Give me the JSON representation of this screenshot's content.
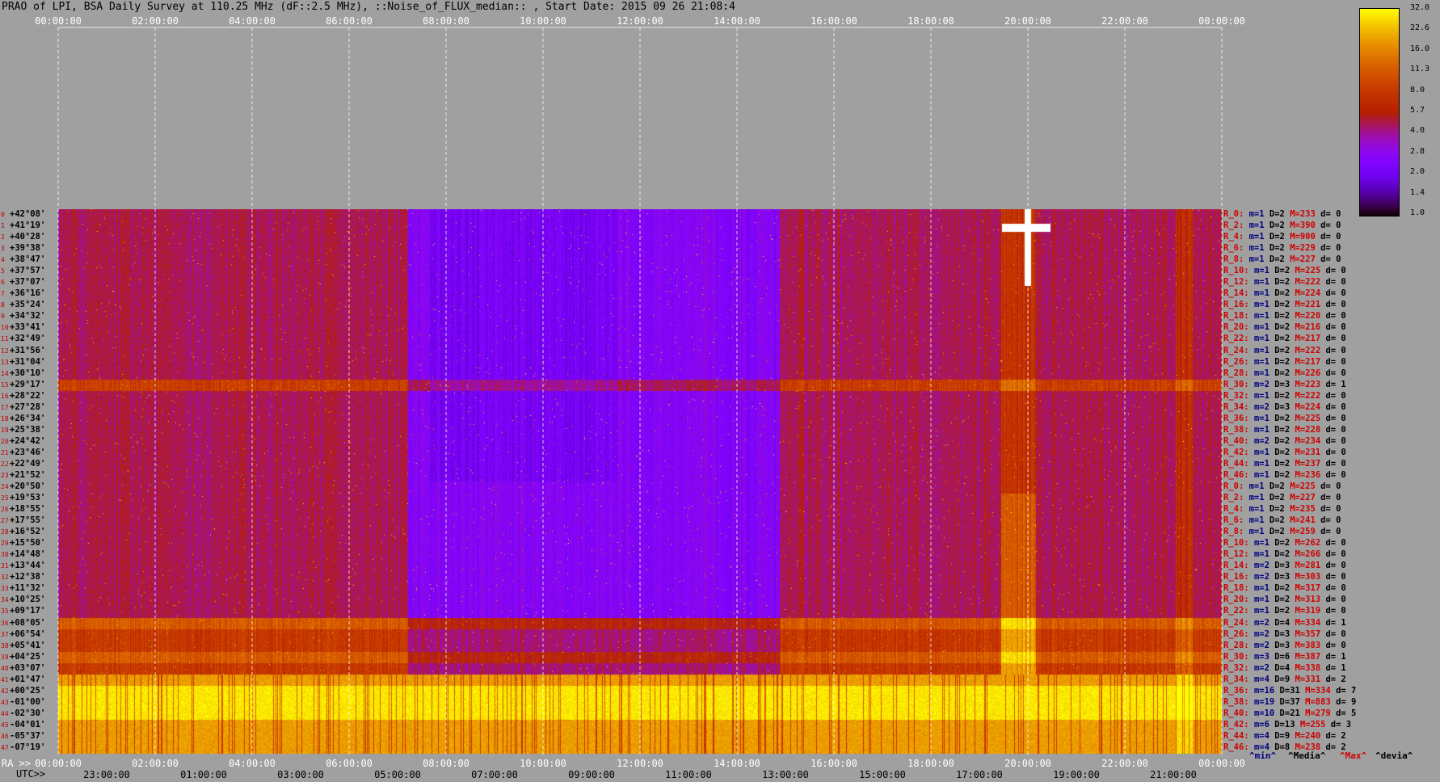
{
  "header": {
    "title": "PRAO of LPI, BSA Daily Survey at 110.25 MHz (dF::2.5 MHz), ::Noise_of_FLUX_median:: , Start Date: 2015 09 26 21:08:4"
  },
  "chart_data": {
    "type": "heatmap",
    "title": "PRAO of LPI, BSA Daily Survey at 110.25 MHz (dF::2.5 MHz), ::Noise_of_FLUX_median:: , Start Date: 2015 09 26 21:08:4",
    "x_top_ticks": [
      "00:00:00",
      "02:00:00",
      "04:00:00",
      "06:00:00",
      "08:00:00",
      "10:00:00",
      "12:00:00",
      "14:00:00",
      "16:00:00",
      "18:00:00",
      "20:00:00",
      "22:00:00",
      "00:00:00"
    ],
    "ra_label": "RA >>",
    "utc_label": "UTC>>",
    "x_bottom_ra_ticks": [
      "00:00:00",
      "02:00:00",
      "04:00:00",
      "06:00:00",
      "08:00:00",
      "10:00:00",
      "12:00:00",
      "14:00:00",
      "16:00:00",
      "18:00:00",
      "20:00:00",
      "22:00:00",
      "00:00:00"
    ],
    "x_bottom_utc_ticks": [
      "23:00:00",
      "01:00:00",
      "03:00:00",
      "05:00:00",
      "07:00:00",
      "09:00:00",
      "11:00:00",
      "13:00:00",
      "15:00:00",
      "17:00:00",
      "19:00:00",
      "21:00:00"
    ],
    "declinations": [
      "+42°08'",
      "+41°19'",
      "+40°28'",
      "+39°38'",
      "+38°47'",
      "+37°57'",
      "+37°07'",
      "+36°16'",
      "+35°24'",
      "+34°32'",
      "+33°41'",
      "+32°49'",
      "+31°56'",
      "+31°04'",
      "+30°10'",
      "+29°17'",
      "+28°22'",
      "+27°28'",
      "+26°34'",
      "+25°38'",
      "+24°42'",
      "+23°46'",
      "+22°49'",
      "+21°52'",
      "+20°50'",
      "+19°53'",
      "+18°55'",
      "+17°55'",
      "+16°52'",
      "+15°50'",
      "+14°48'",
      "+13°44'",
      "+12°38'",
      "+11°32'",
      "+10°25'",
      "+09°17'",
      "+08°05'",
      "+06°54'",
      "+05°41'",
      "+04°25'",
      "+03°07'",
      "+01°47'",
      "+00°25'",
      "-01°00'",
      "-02°30'",
      "-04°01'",
      "-05°37'",
      "-07°19'"
    ],
    "row_indices": [
      "0",
      "1",
      "2",
      "3",
      "4",
      "5",
      "6",
      "7",
      "8",
      "9",
      "10",
      "11",
      "12",
      "13",
      "14",
      "15",
      "16",
      "17",
      "18",
      "19",
      "20",
      "21",
      "22",
      "23",
      "24",
      "25",
      "26",
      "27",
      "28",
      "29",
      "30",
      "31",
      "32",
      "33",
      "34",
      "35",
      "36",
      "37",
      "38",
      "39",
      "40",
      "41",
      "42",
      "43",
      "44",
      "45",
      "46",
      "47"
    ],
    "row_stats": [
      {
        "r": "R_0:",
        "min": "m=1",
        "med": "D=2",
        "max": "M=233",
        "dev": "d= 0"
      },
      {
        "r": "R_2:",
        "min": "m=1",
        "med": "D=2",
        "max": "M=390",
        "dev": "d= 0"
      },
      {
        "r": "R_4:",
        "min": "m=1",
        "med": "D=2",
        "max": "M=900",
        "dev": "d= 0"
      },
      {
        "r": "R_6:",
        "min": "m=1",
        "med": "D=2",
        "max": "M=229",
        "dev": "d= 0"
      },
      {
        "r": "R_8:",
        "min": "m=1",
        "med": "D=2",
        "max": "M=227",
        "dev": "d= 0"
      },
      {
        "r": "R_10:",
        "min": "m=1",
        "med": "D=2",
        "max": "M=225",
        "dev": "d= 0"
      },
      {
        "r": "R_12:",
        "min": "m=1",
        "med": "D=2",
        "max": "M=222",
        "dev": "d= 0"
      },
      {
        "r": "R_14:",
        "min": "m=1",
        "med": "D=2",
        "max": "M=224",
        "dev": "d= 0"
      },
      {
        "r": "R_16:",
        "min": "m=1",
        "med": "D=2",
        "max": "M=221",
        "dev": "d= 0"
      },
      {
        "r": "R_18:",
        "min": "m=1",
        "med": "D=2",
        "max": "M=220",
        "dev": "d= 0"
      },
      {
        "r": "R_20:",
        "min": "m=1",
        "med": "D=2",
        "max": "M=216",
        "dev": "d= 0"
      },
      {
        "r": "R_22:",
        "min": "m=1",
        "med": "D=2",
        "max": "M=217",
        "dev": "d= 0"
      },
      {
        "r": "R_24:",
        "min": "m=1",
        "med": "D=2",
        "max": "M=222",
        "dev": "d= 0"
      },
      {
        "r": "R_26:",
        "min": "m=1",
        "med": "D=2",
        "max": "M=217",
        "dev": "d= 0"
      },
      {
        "r": "R_28:",
        "min": "m=1",
        "med": "D=2",
        "max": "M=226",
        "dev": "d= 0"
      },
      {
        "r": "R_30:",
        "min": "m=2",
        "med": "D=3",
        "max": "M=223",
        "dev": "d= 1"
      },
      {
        "r": "R_32:",
        "min": "m=1",
        "med": "D=2",
        "max": "M=222",
        "dev": "d= 0"
      },
      {
        "r": "R_34:",
        "min": "m=2",
        "med": "D=3",
        "max": "M=224",
        "dev": "d= 0"
      },
      {
        "r": "R_36:",
        "min": "m=1",
        "med": "D=2",
        "max": "M=225",
        "dev": "d= 0"
      },
      {
        "r": "R_38:",
        "min": "m=1",
        "med": "D=2",
        "max": "M=228",
        "dev": "d= 0"
      },
      {
        "r": "R_40:",
        "min": "m=2",
        "med": "D=2",
        "max": "M=234",
        "dev": "d= 0"
      },
      {
        "r": "R_42:",
        "min": "m=1",
        "med": "D=2",
        "max": "M=231",
        "dev": "d= 0"
      },
      {
        "r": "R_44:",
        "min": "m=1",
        "med": "D=2",
        "max": "M=237",
        "dev": "d= 0"
      },
      {
        "r": "R_46:",
        "min": "m=1",
        "med": "D=2",
        "max": "M=236",
        "dev": "d= 0"
      },
      {
        "r": "R_0:",
        "min": "m=1",
        "med": "D=2",
        "max": "M=225",
        "dev": "d= 0"
      },
      {
        "r": "R_2:",
        "min": "m=1",
        "med": "D=2",
        "max": "M=227",
        "dev": "d= 0"
      },
      {
        "r": "R_4:",
        "min": "m=1",
        "med": "D=2",
        "max": "M=235",
        "dev": "d= 0"
      },
      {
        "r": "R_6:",
        "min": "m=1",
        "med": "D=2",
        "max": "M=241",
        "dev": "d= 0"
      },
      {
        "r": "R_8:",
        "min": "m=1",
        "med": "D=2",
        "max": "M=259",
        "dev": "d= 0"
      },
      {
        "r": "R_10:",
        "min": "m=1",
        "med": "D=2",
        "max": "M=262",
        "dev": "d= 0"
      },
      {
        "r": "R_12:",
        "min": "m=1",
        "med": "D=2",
        "max": "M=266",
        "dev": "d= 0"
      },
      {
        "r": "R_14:",
        "min": "m=2",
        "med": "D=3",
        "max": "M=281",
        "dev": "d= 0"
      },
      {
        "r": "R_16:",
        "min": "m=2",
        "med": "D=3",
        "max": "M=303",
        "dev": "d= 0"
      },
      {
        "r": "R_18:",
        "min": "m=1",
        "med": "D=2",
        "max": "M=317",
        "dev": "d= 0"
      },
      {
        "r": "R_20:",
        "min": "m=1",
        "med": "D=2",
        "max": "M=313",
        "dev": "d= 0"
      },
      {
        "r": "R_22:",
        "min": "m=1",
        "med": "D=2",
        "max": "M=319",
        "dev": "d= 0"
      },
      {
        "r": "R_24:",
        "min": "m=2",
        "med": "D=4",
        "max": "M=334",
        "dev": "d= 1"
      },
      {
        "r": "R_26:",
        "min": "m=2",
        "med": "D=3",
        "max": "M=357",
        "dev": "d= 0"
      },
      {
        "r": "R_28:",
        "min": "m=2",
        "med": "D=3",
        "max": "M=383",
        "dev": "d= 0"
      },
      {
        "r": "R_30:",
        "min": "m=3",
        "med": "D=6",
        "max": "M=387",
        "dev": "d= 1"
      },
      {
        "r": "R_32:",
        "min": "m=2",
        "med": "D=4",
        "max": "M=338",
        "dev": "d= 1"
      },
      {
        "r": "R_34:",
        "min": "m=4",
        "med": "D=9",
        "max": "M=331",
        "dev": "d= 2"
      },
      {
        "r": "R_36:",
        "min": "m=16",
        "med": "D=31",
        "max": "M=334",
        "dev": "d= 7"
      },
      {
        "r": "R_38:",
        "min": "m=19",
        "med": "D=37",
        "max": "M=883",
        "dev": "d= 9"
      },
      {
        "r": "R_40:",
        "min": "m=10",
        "med": "D=21",
        "max": "M=279",
        "dev": "d= 5"
      },
      {
        "r": "R_42:",
        "min": "m=6",
        "med": "D=13",
        "max": "M=255",
        "dev": "d= 3"
      },
      {
        "r": "R_44:",
        "min": "m=4",
        "med": "D=9",
        "max": "M=240",
        "dev": "d= 2"
      },
      {
        "r": "R_46:",
        "min": "m=4",
        "med": "D=8",
        "max": "M=238",
        "dev": "d= 2"
      }
    ],
    "colorbar_ticks": [
      "32.0",
      "22.6",
      "16.0",
      "11.3",
      "8.0",
      "5.7",
      "4.0",
      "2.8",
      "2.0",
      "1.4",
      "1.0"
    ],
    "colorbar_range": [
      1.0,
      32.0
    ],
    "colorbar_scale": "log",
    "legend": {
      "min": "^min^",
      "med": "^Media^",
      "max": "^Max^",
      "dev": "^devia^"
    },
    "colors": {
      "min": "#000080",
      "med": "#000000",
      "max": "#d00000",
      "dev": "#000000",
      "background": "#a0a0a0"
    }
  }
}
